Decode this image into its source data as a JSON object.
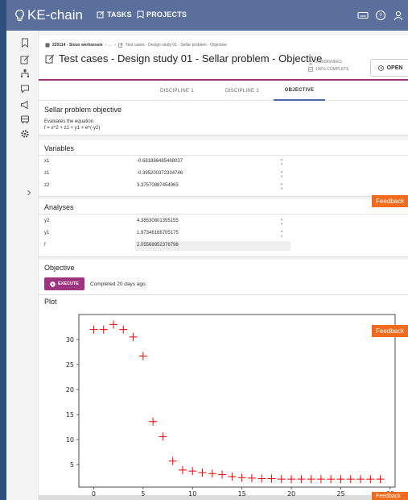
{
  "app": {
    "name": "KE-chain"
  },
  "topnav": {
    "tasks": "TASKS",
    "projects": "PROJECTS"
  },
  "breadcrumb": {
    "project": "220114 - Sioux werksessie",
    "ellipsis": "...",
    "item": "Test cases - Design study 01 - Sellar problem - Objective"
  },
  "page": {
    "title": "Test cases - Design study 01 - Sellar problem - Objective",
    "assignees": "2 ASSIGNEES",
    "complete": "100% COMPLETE",
    "open_label": "OPEN"
  },
  "tabs": [
    {
      "label": "DISCIPLINE 1",
      "active": false
    },
    {
      "label": "DISCIPLINE 2",
      "active": false
    },
    {
      "label": "OBJECTIVE",
      "active": true
    }
  ],
  "description_card": {
    "title": "Sellar problem objective",
    "line1": "Evaluates the equation",
    "line2": "f = x^2 + z1 + y1 + e^(-y2)"
  },
  "variables_card": {
    "title": "Variables",
    "rows": [
      {
        "name": "x1",
        "value": "-0.681886485468037"
      },
      {
        "name": "z1",
        "value": "-0.395200372334746"
      },
      {
        "name": "z2",
        "value": "3.37570887454963"
      }
    ]
  },
  "analyses_card": {
    "title": "Analyses",
    "rows": [
      {
        "name": "y2",
        "value": "4.38530801355155"
      },
      {
        "name": "y1",
        "value": "1.97346166705175"
      },
      {
        "name": "f",
        "value": "2.05568952376798"
      }
    ]
  },
  "objective_card": {
    "title": "Objective",
    "execute_label": "EXECUTE",
    "status": "Completed 20 days ago."
  },
  "plot_card": {
    "title": "Plot"
  },
  "feedback_label": "Feedback",
  "colors": {
    "topbar": "#5b6f9d",
    "accent": "#a0357f",
    "feedback": "#f26b1d",
    "marker": "#ff0000"
  },
  "chart_data": {
    "type": "scatter",
    "marker": "+",
    "x": [
      0,
      1,
      2,
      3,
      4,
      5,
      6,
      7,
      8,
      9,
      10,
      11,
      12,
      13,
      14,
      15,
      16,
      17,
      18,
      19,
      20,
      21,
      22,
      23,
      24,
      25,
      26,
      27,
      28,
      29
    ],
    "y": [
      32,
      32,
      33,
      32,
      30.5,
      26.7,
      13.6,
      10.6,
      5.7,
      3.9,
      3.7,
      3.4,
      3.2,
      3.0,
      2.6,
      2.4,
      2.3,
      2.2,
      2.2,
      2.1,
      2.1,
      2.1,
      2.1,
      2.1,
      2.1,
      2.1,
      2.1,
      2.1,
      2.1,
      2.1
    ],
    "xticks": [
      "0",
      "5",
      "10",
      "15",
      "20",
      "25",
      "30"
    ],
    "yticks": [
      "5",
      "10",
      "15",
      "20",
      "25",
      "30"
    ],
    "xlim": [
      -1.5,
      30.5
    ],
    "ylim": [
      0.5,
      35
    ],
    "grid": false
  }
}
